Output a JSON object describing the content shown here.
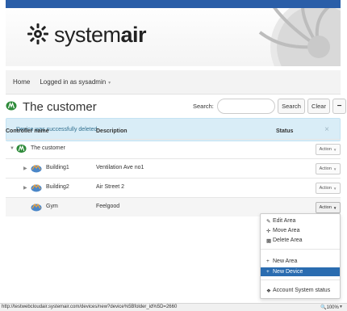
{
  "brand": {
    "logo_text_light": "system",
    "logo_text_bold": "air"
  },
  "navbar": {
    "home": "Home",
    "user": "Logged in as sysadmin"
  },
  "header": {
    "title": "The customer",
    "search_label": "Search:",
    "search_value": "",
    "search_button": "Search",
    "clear_button": "Clear",
    "collapse_button": "−"
  },
  "alert": {
    "message": "Device was successfully deleted",
    "close": "×"
  },
  "table": {
    "headers": {
      "name": "Controller name",
      "description": "Description",
      "status": "Status"
    },
    "action_label": "Action",
    "rows": [
      {
        "name": "The customer",
        "description": "",
        "icon": "customer-icon"
      },
      {
        "name": "Building1",
        "description": "Ventilation Ave no1",
        "icon": "building-icon"
      },
      {
        "name": "Building2",
        "description": "Air Street 2",
        "icon": "building-icon"
      },
      {
        "name": "Gym",
        "description": "Feelgood",
        "icon": "building-icon"
      }
    ]
  },
  "action_menu": {
    "items": [
      {
        "label": "Edit Area",
        "icon": "edit-icon"
      },
      {
        "label": "Move Area",
        "icon": "move-icon"
      },
      {
        "label": "Delete Area",
        "icon": "trash-icon"
      },
      {
        "label": "New Area",
        "icon": "plus-icon"
      },
      {
        "label": "New Device",
        "icon": "plus-icon"
      },
      {
        "label": "Account System status",
        "icon": "info-icon"
      }
    ],
    "highlighted_item": "New Device"
  },
  "statusbar": {
    "url": "http://testwebcloudair.systemair.com/devices/new?device%5Bfolder_id%5D=2660",
    "zoom": "100%"
  },
  "colors": {
    "banner": "#2a5ea8",
    "alert_bg": "#d9edf7",
    "alert_text": "#31708f",
    "menu_active": "#2a6cb0",
    "brand_green": "#2e8b3a"
  }
}
